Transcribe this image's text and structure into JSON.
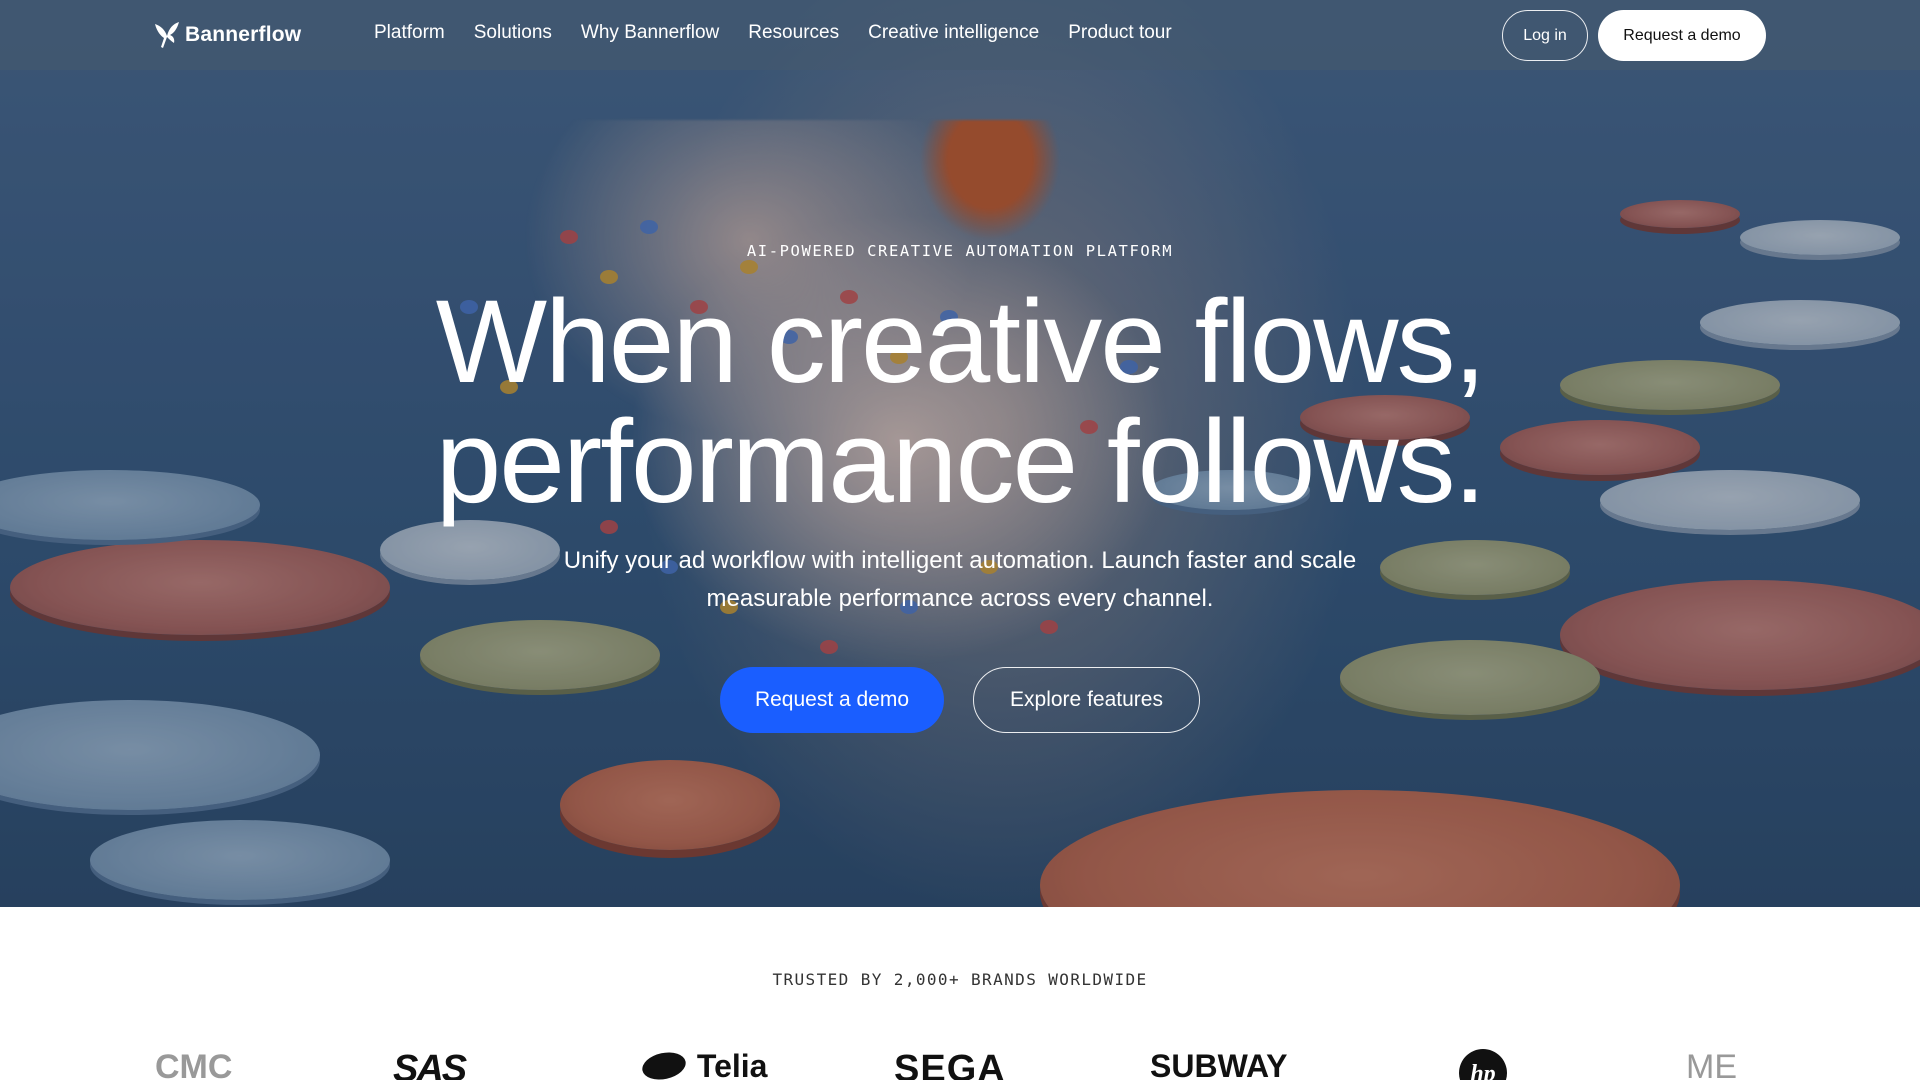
{
  "nav": {
    "brand": "Bannerflow",
    "links": [
      "Platform",
      "Solutions",
      "Why Bannerflow",
      "Resources",
      "Creative intelligence",
      "Product tour"
    ],
    "login_label": "Log in",
    "demo_label": "Request a demo"
  },
  "hero": {
    "eyebrow": "AI-POWERED CREATIVE AUTOMATION PLATFORM",
    "headline_line1": "When creative flows,",
    "headline_line2": "performance follows.",
    "subtext": "Unify your ad workflow with intelligent automation. Launch faster and scale measurable performance across every channel.",
    "primary_cta": "Request a demo",
    "secondary_cta": "Explore features"
  },
  "trusted": {
    "label": "TRUSTED BY 2,000+ BRANDS WORLDWIDE",
    "brands": [
      "CMC",
      "SAS",
      "Telia",
      "SEGA",
      "SUBWAY",
      "hp",
      "ME"
    ]
  },
  "colors": {
    "primary_button": "#1a5eff",
    "nav_background": "rgba(70,90,110,0.55)"
  }
}
